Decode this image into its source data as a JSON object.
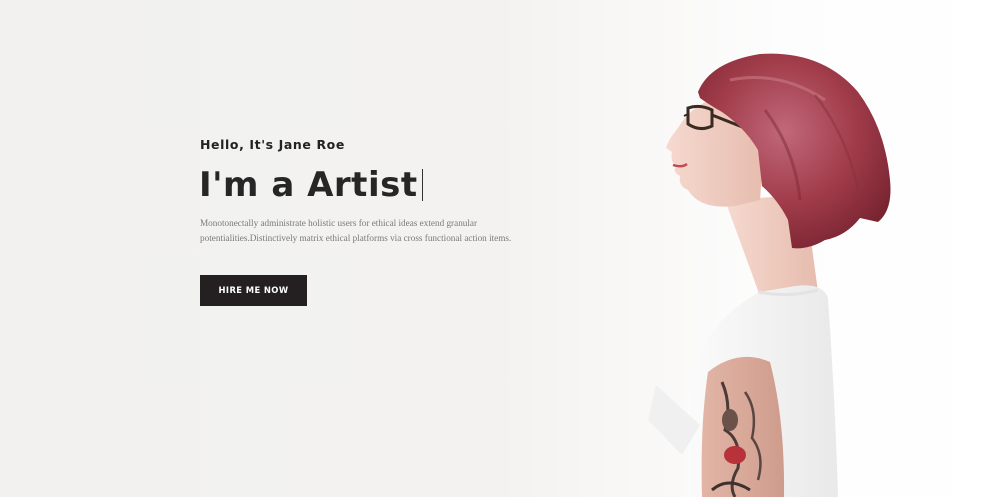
{
  "hero": {
    "greeting": "Hello, It's Jane Roe",
    "headline": "I'm a Artist",
    "description": "Monotonectally administrate holistic users for ethical ideas extend granular potentialities.Distinctively matrix ethical platforms via cross functional action items.",
    "cta_label": "HIRE ME NOW"
  },
  "colors": {
    "background": "#f3f2f1",
    "button_bg": "#242021",
    "heading_text": "#262626",
    "body_text": "#7a7a7a",
    "hair": "#a23d4b",
    "shirt": "#f7f7f7"
  }
}
